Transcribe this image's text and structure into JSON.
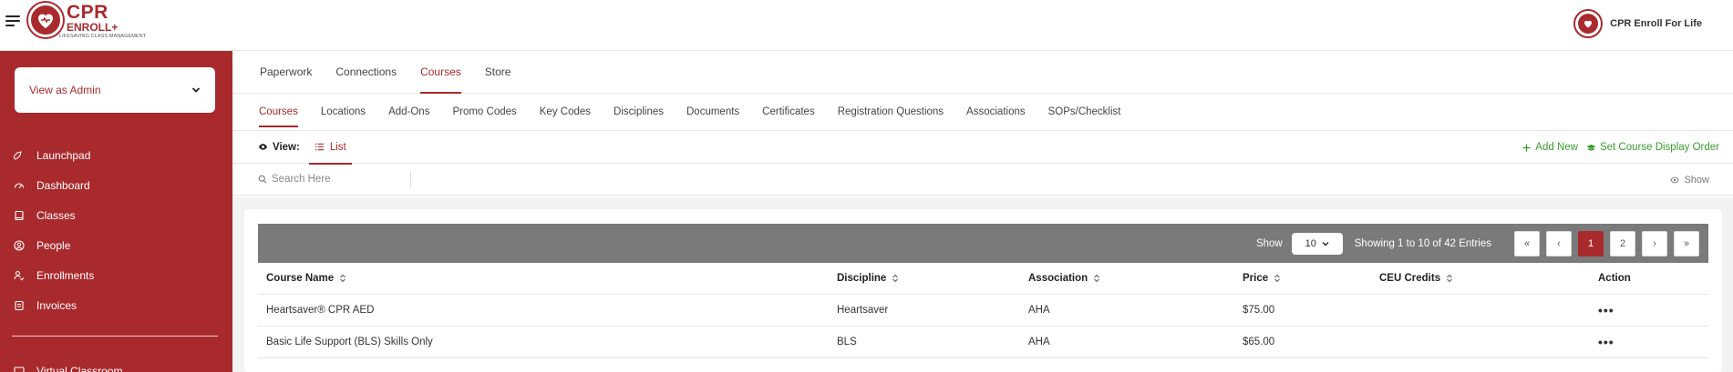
{
  "header": {
    "logo_cpr": "CPR",
    "logo_enroll": "ENROLL+",
    "logo_tagline": "LIFESAVING CLASS MANAGEMENT",
    "org_name": "CPR Enroll For Life"
  },
  "sidebar": {
    "role_select": "View as Admin",
    "items": [
      {
        "label": "Launchpad",
        "icon": "rocket-icon"
      },
      {
        "label": "Dashboard",
        "icon": "gauge-icon"
      },
      {
        "label": "Classes",
        "icon": "book-icon"
      },
      {
        "label": "People",
        "icon": "user-circle-icon"
      },
      {
        "label": "Enrollments",
        "icon": "user-check-icon"
      },
      {
        "label": "Invoices",
        "icon": "invoice-icon"
      }
    ],
    "cut_item": "Virtual Classroom"
  },
  "tabs_primary": [
    {
      "label": "Paperwork",
      "active": false
    },
    {
      "label": "Connections",
      "active": false
    },
    {
      "label": "Courses",
      "active": true
    },
    {
      "label": "Store",
      "active": false
    }
  ],
  "tabs_secondary": [
    {
      "label": "Courses",
      "active": true
    },
    {
      "label": "Locations",
      "active": false
    },
    {
      "label": "Add-Ons",
      "active": false
    },
    {
      "label": "Promo Codes",
      "active": false
    },
    {
      "label": "Key Codes",
      "active": false
    },
    {
      "label": "Disciplines",
      "active": false
    },
    {
      "label": "Documents",
      "active": false
    },
    {
      "label": "Certificates",
      "active": false
    },
    {
      "label": "Registration Questions",
      "active": false
    },
    {
      "label": "Associations",
      "active": false
    },
    {
      "label": "SOPs/Checklist",
      "active": false
    }
  ],
  "viewbar": {
    "view_label": "View:",
    "list_label": "List",
    "add_new": "Add New",
    "display_order": "Set Course Display Order"
  },
  "search": {
    "placeholder": "Search Here",
    "show_columns": "Show"
  },
  "table_toolbar": {
    "show_label": "Show",
    "per_page": "10",
    "entries_text": "Showing 1 to 10 of 42 Entries",
    "pagination": [
      "«",
      "‹",
      "1",
      "2",
      "›",
      "»"
    ],
    "active_page": "1"
  },
  "table": {
    "columns": [
      "Course Name",
      "Discipline",
      "Association",
      "Price",
      "CEU Credits",
      "Action"
    ],
    "rows": [
      [
        "Heartsaver® CPR AED",
        "Heartsaver",
        "AHA",
        "$75.00",
        "",
        "•••"
      ],
      [
        "Basic Life Support (BLS) Skills Only",
        "BLS",
        "AHA",
        "$65.00",
        "",
        "•••"
      ]
    ]
  },
  "colors": {
    "brand": "#a92a2d",
    "action_green": "#3a9a2e",
    "toolbar_gray": "#7a7a7a"
  }
}
